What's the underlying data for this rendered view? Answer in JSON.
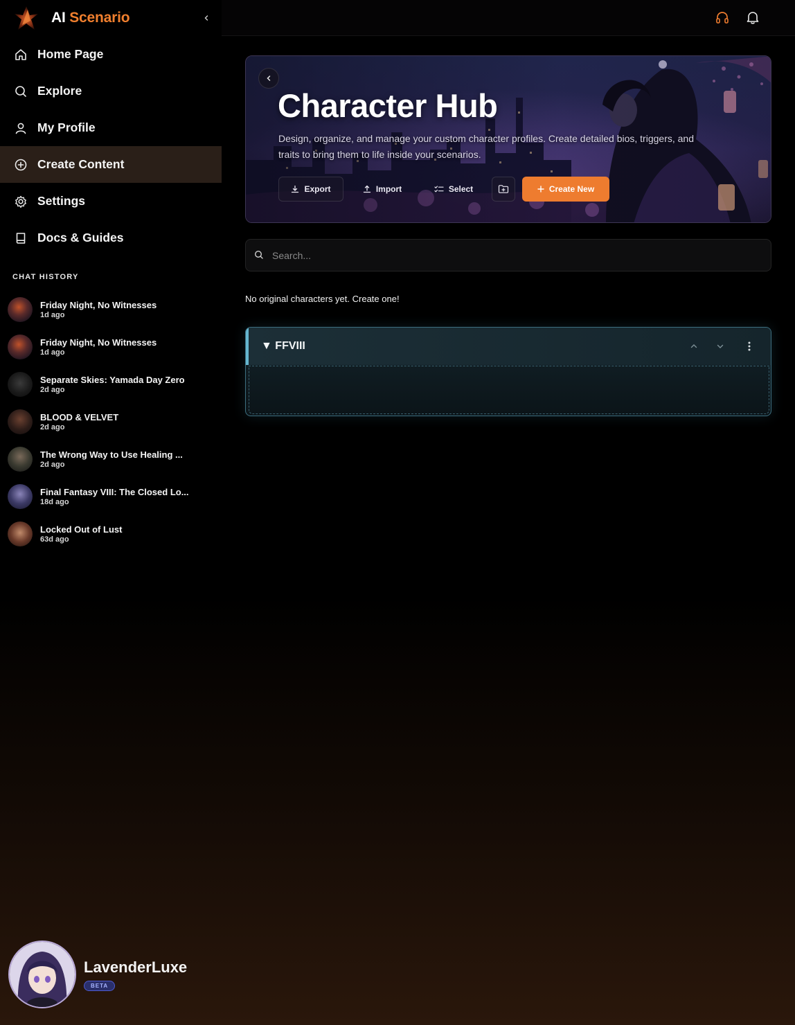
{
  "brand": {
    "name_part1": "AI",
    "name_part2": "Scenario",
    "logo_icon": "flame-logo-icon"
  },
  "nav": {
    "items": [
      {
        "label": "Home Page",
        "icon": "home-icon"
      },
      {
        "label": "Explore",
        "icon": "search-icon"
      },
      {
        "label": "My Profile",
        "icon": "user-icon"
      },
      {
        "label": "Create Content",
        "icon": "plus-circle-icon",
        "active": true
      },
      {
        "label": "Settings",
        "icon": "gear-icon"
      },
      {
        "label": "Docs & Guides",
        "icon": "book-icon"
      }
    ]
  },
  "chat_history": {
    "title": "CHAT HISTORY",
    "items": [
      {
        "name": "Friday Night, No Witnesses",
        "time": "1d ago"
      },
      {
        "name": "Friday Night, No Witnesses",
        "time": "1d ago"
      },
      {
        "name": "Separate Skies: Yamada Day Zero",
        "time": "2d ago"
      },
      {
        "name": "BLOOD & VELVET",
        "time": "2d ago"
      },
      {
        "name": "The Wrong Way to Use Healing ...",
        "time": "2d ago"
      },
      {
        "name": "Final Fantasy VIII: The Closed Lo...",
        "time": "18d ago"
      },
      {
        "name": "Locked Out of Lust",
        "time": "63d ago"
      }
    ]
  },
  "user": {
    "name": "LavenderLuxe",
    "badge": "BETA"
  },
  "hero": {
    "title": "Character Hub",
    "description": "Design, organize, and manage your custom character profiles. Create detailed bios, triggers, and traits to bring them to life inside your scenarios.",
    "buttons": {
      "export": "Export",
      "import": "Import",
      "select": "Select",
      "create": "Create New"
    }
  },
  "search": {
    "placeholder": "Search..."
  },
  "empty_message": "No original characters yet. Create one!",
  "group": {
    "title": "FFVIII",
    "expanded_glyph": "▼"
  },
  "colors": {
    "accent": "#ee7c2f",
    "group_border": "#3d6f80",
    "group_bar": "#66b6cf"
  }
}
